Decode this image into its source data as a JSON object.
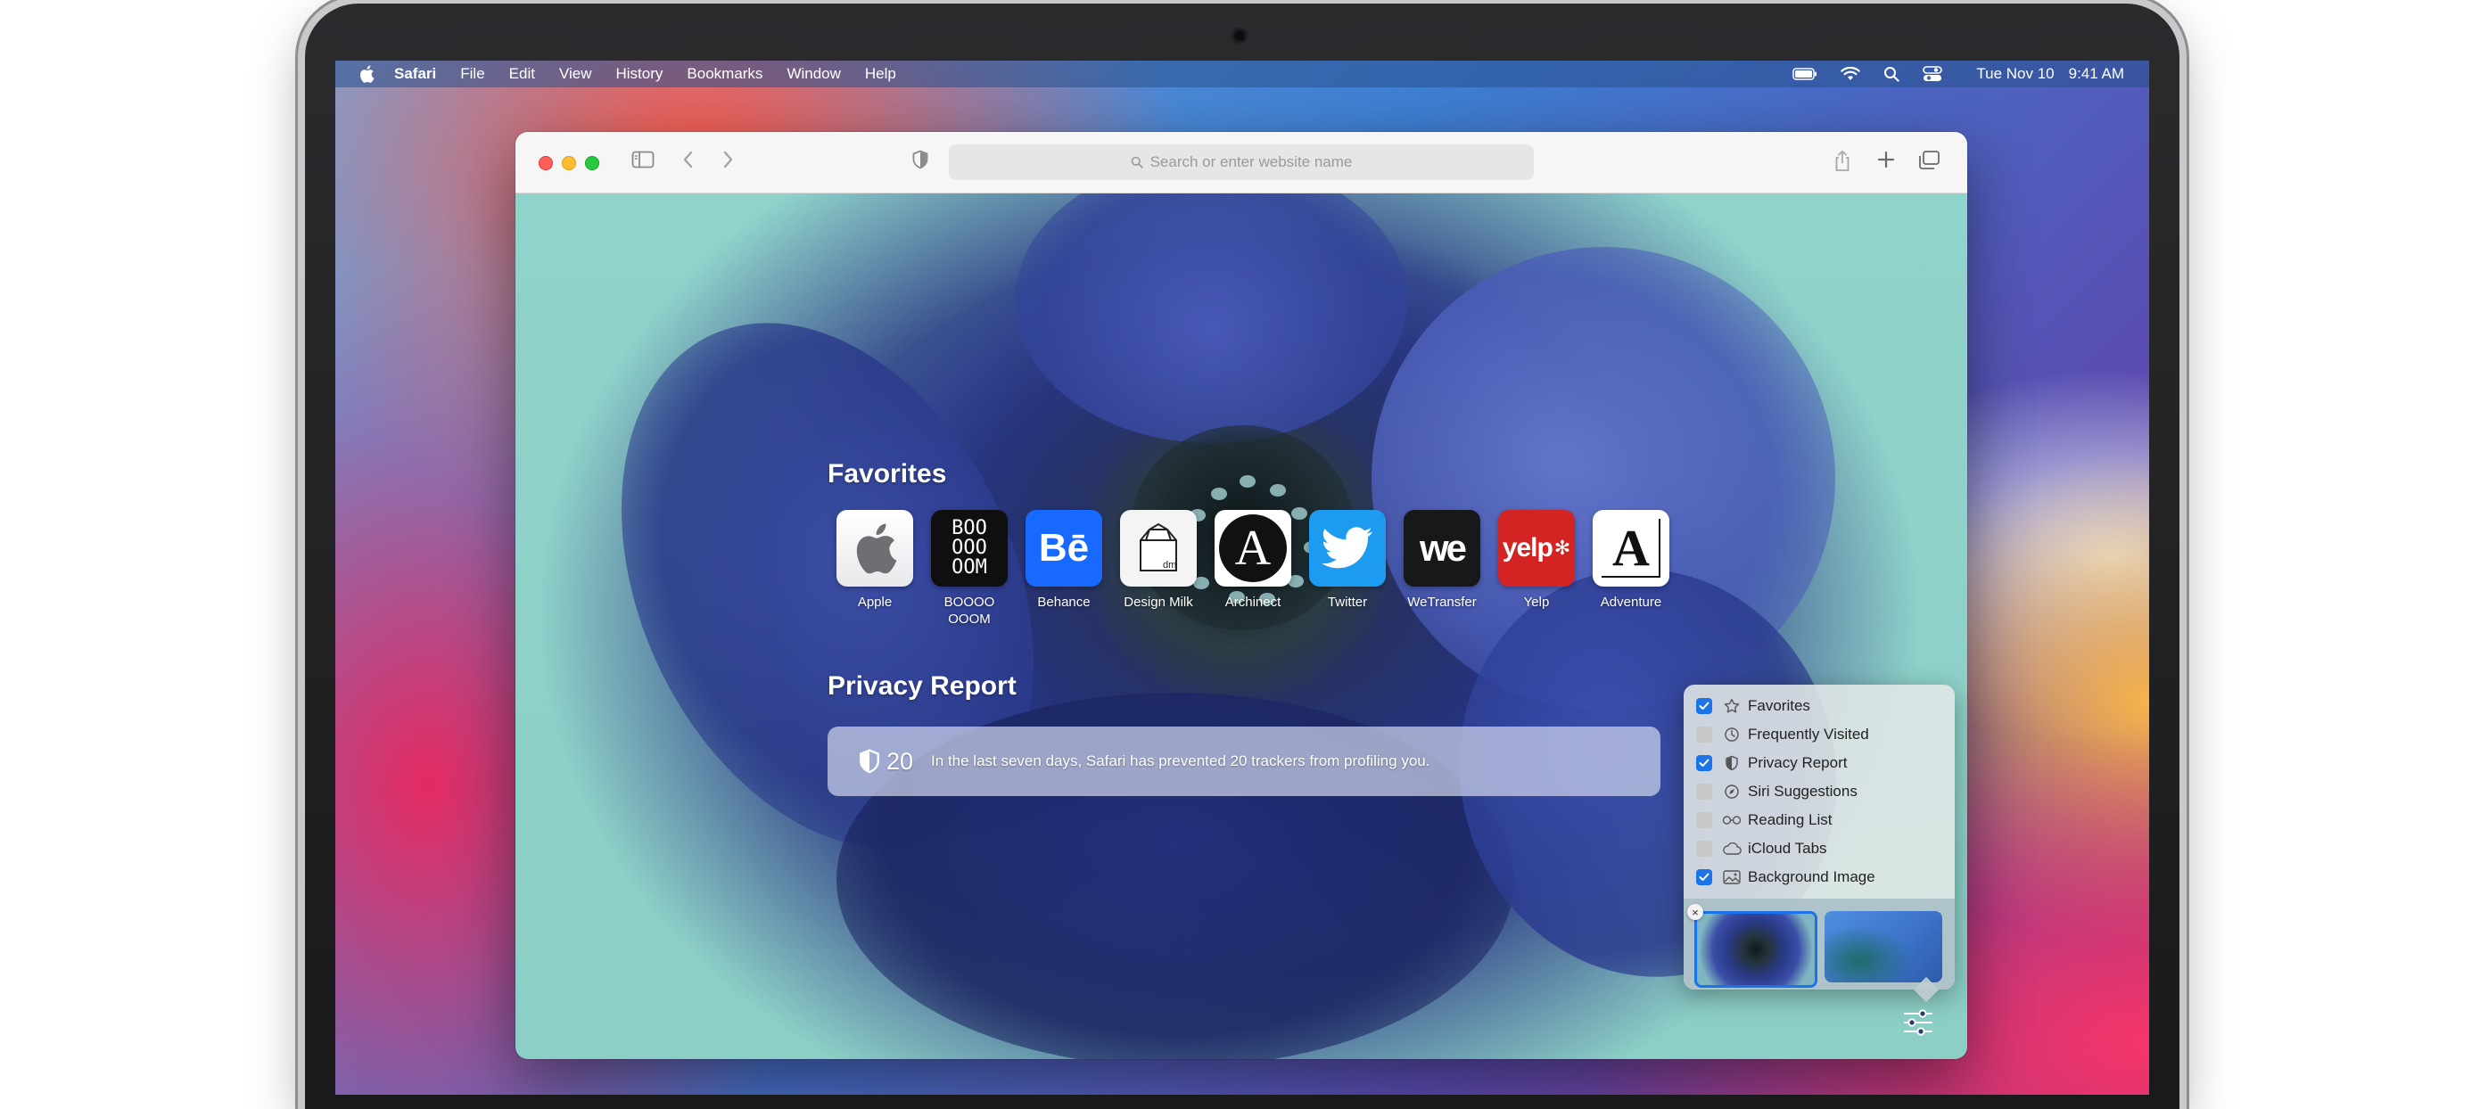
{
  "menubar": {
    "items": [
      "Safari",
      "File",
      "Edit",
      "View",
      "History",
      "Bookmarks",
      "Window",
      "Help"
    ],
    "date": "Tue Nov 10",
    "time": "9:41 AM"
  },
  "toolbar": {
    "search_placeholder": "Search or enter website name"
  },
  "favorites": {
    "title": "Favorites",
    "items": [
      {
        "label": "Apple",
        "tile_text": ""
      },
      {
        "label": "BOOOO OOOM",
        "tile_text": "BOO OOO OOM"
      },
      {
        "label": "Behance",
        "tile_text": "Bē"
      },
      {
        "label": "Design Milk",
        "tile_text": "dm"
      },
      {
        "label": "Archinect",
        "tile_text": "A"
      },
      {
        "label": "Twitter",
        "tile_text": ""
      },
      {
        "label": "WeTransfer",
        "tile_text": "we"
      },
      {
        "label": "Yelp",
        "tile_text": "yelp"
      },
      {
        "label": "Adventure",
        "tile_text": "A"
      }
    ]
  },
  "privacy": {
    "title": "Privacy Report",
    "count": "20",
    "message": "In the last seven days, Safari has prevented 20 trackers from profiling you."
  },
  "customize": {
    "options": [
      {
        "label": "Favorites",
        "checked": true,
        "icon": "star-icon"
      },
      {
        "label": "Frequently Visited",
        "checked": false,
        "icon": "clock-icon"
      },
      {
        "label": "Privacy Report",
        "checked": true,
        "icon": "shield-icon"
      },
      {
        "label": "Siri Suggestions",
        "checked": false,
        "icon": "compass-icon"
      },
      {
        "label": "Reading List",
        "checked": false,
        "icon": "glasses-icon"
      },
      {
        "label": "iCloud Tabs",
        "checked": false,
        "icon": "cloud-icon"
      },
      {
        "label": "Background Image",
        "checked": true,
        "icon": "image-icon"
      }
    ]
  },
  "colors": {
    "accent": "#1a73e8",
    "traffic_red": "#ff5f57",
    "traffic_yellow": "#febc2e",
    "traffic_green": "#28c840"
  }
}
